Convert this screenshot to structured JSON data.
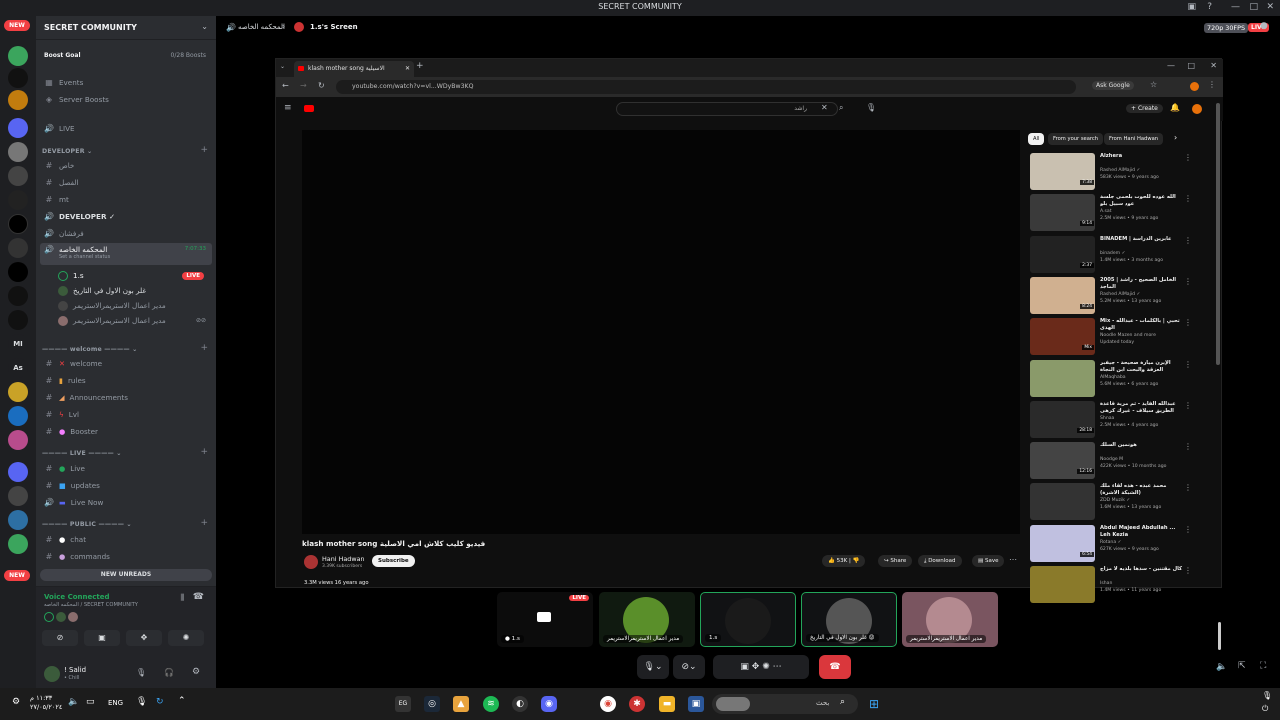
{
  "window": {
    "title": "SECRET COMMUNITY"
  },
  "server": {
    "name": "SECRET COMMUNITY",
    "boost_goal_label": "Boost Goal",
    "boost_count": "0/28 Boosts",
    "menu": [
      "Events",
      "Server Boosts"
    ],
    "live_channel": "LIVE",
    "categories": {
      "developer": "DEVELOPER",
      "welcome": "welcome",
      "live": "LIVE",
      "public": "PUBLIC"
    },
    "developer_channels": [
      "خاص",
      "الفصل",
      "mt"
    ],
    "developer_voice": "DEVELOPER ✓",
    "voice_channel_2": "فرفشان",
    "active_voice": {
      "name": "المحكمه الخاصه",
      "timer": "7:07:33",
      "status": "Set a channel status"
    },
    "voice_users": [
      {
        "name": "1.s",
        "live": "LIVE"
      },
      {
        "name": "غلر بون الاول في التاريخ"
      },
      {
        "name": "مدير اعمال الاستريمرالاستريمر"
      },
      {
        "name": "مدير اعمال الاستريمرالاستريمر"
      }
    ],
    "welcome_channels": [
      "welcome",
      "rules",
      "Announcements",
      "Lvl",
      "Booster"
    ],
    "live_channels": [
      "Live",
      "updates",
      "Live Now"
    ],
    "public_channels": [
      "chat",
      "commands"
    ],
    "new_unreads": "NEW UNREADS"
  },
  "rail_badges": {
    "new_top": "NEW",
    "new_bottom": "NEW"
  },
  "voice_panel": {
    "status": "Voice Connected",
    "location": "المحكمه الخاصه / SECRET COMMUNITY"
  },
  "user_panel": {
    "name": "! Salid",
    "status": "• Chill"
  },
  "header": {
    "channel": "المحكمه الخاصه",
    "screen": "1.s's Screen",
    "quality": "720p 30FPS",
    "live": "LIVE"
  },
  "browser": {
    "tab_title": "klash mother song الاسيلية",
    "url": "youtube.com/watch?v=vl...WDyBw3KQ",
    "ask_google": "Ask Google"
  },
  "youtube": {
    "search_text": "راشد",
    "create": "Create",
    "video_title": "klash mother song فيديو كليب كلاش امي الاصلية",
    "channel": "Hani Hadwan",
    "subscribers": "3.39K subscribers",
    "subscribe": "Subscribe",
    "likes": "53K",
    "share": "Share",
    "download": "Download",
    "save": "Save",
    "views": "3.3M views 16 years ago",
    "chips": [
      "All",
      "From your search",
      "From Hani Hadwan"
    ],
    "recommendations": [
      {
        "title": "Alzhera",
        "channel": "Rashed AlMajid ✓",
        "meta": "583K views • 9 years ago",
        "duration": "7:38"
      },
      {
        "title": "الله عوده للحوت بلحمى جلسة عود سبيل بلو",
        "channel": "A.sat",
        "meta": "2.5M views • 9 years ago",
        "duration": "9:14"
      },
      {
        "title": "BINADEM | عابرين الدراسة",
        "channel": "binadem ✓",
        "meta": "1.4M views • 3 months ago",
        "duration": "2:37"
      },
      {
        "title": "2005 | الخامل الصحيح - راشد الماجد",
        "channel": "Rashed AlMajid ✓",
        "meta": "5.2M views • 13 years ago",
        "duration": "8:24"
      },
      {
        "title": "Mix - تحبي | بالكلمات - عبدالله الهدى",
        "channel": "Noodle Mazen and more",
        "meta": "Updated today",
        "duration": "Mix"
      },
      {
        "title": "الإيرن ميارة صحيحة - جيفبر العزقة والبحث ابن النجاة بالطاقة",
        "channel": "AlMaqhaba",
        "meta": "5.6M views • 6 years ago",
        "duration": ""
      },
      {
        "title": "عبدالله الفايد - ثم مرية قاعدة الطريق سيلاف - غيرك كرهى",
        "channel": "Shnaa",
        "meta": "2.5M views • 4 years ago",
        "duration": "28:18"
      },
      {
        "title": "هونمين السلك",
        "channel": "Noodge M",
        "meta": "422K views • 10 months ago",
        "duration": "12:16"
      },
      {
        "title": "محمد عبده - هذه لقاء ملك (الشبكة الاشرة)",
        "channel": "ZDD Muzik ✓",
        "meta": "1.6M views • 13 years ago",
        "duration": ""
      },
      {
        "title": "Abdul Majeed Abdullah ... Leh Kezia",
        "channel": "Rotana ✓",
        "meta": "627K views • 9 years ago",
        "duration": "6:54"
      },
      {
        "title": "كال مقتنين - سدها بلديه لا مزاج",
        "channel": "Ishan",
        "meta": "1.4M views • 11 years ago",
        "duration": ""
      }
    ]
  },
  "tiles": [
    {
      "name": "1.s",
      "live": "LIVE"
    },
    {
      "name": "مدير اعمال الاستريمرالاستريمر"
    },
    {
      "name": "1.s"
    },
    {
      "name": "غلر بون الاول في التاريخ 😡"
    },
    {
      "name": "مدير اعمال الاستريمرالاستريمر"
    }
  ],
  "taskbar": {
    "time": "١١:٣٣ م",
    "date": "٢٧/٠٥/٢٠٢٤",
    "language": "ENG",
    "search_placeholder": "بحث"
  },
  "colors": {
    "live": "#f23f43",
    "voice_green": "#23a55a",
    "discord_bg": "#2b2d31",
    "rail_bg": "#1e1f22"
  }
}
